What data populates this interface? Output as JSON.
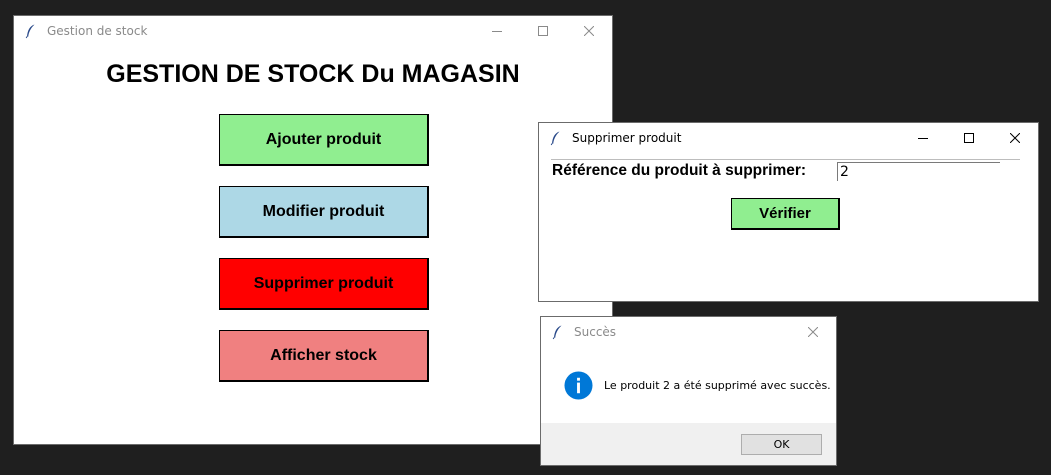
{
  "main_window": {
    "title": "Gestion de stock",
    "heading": "GESTION DE STOCK Du MAGASIN",
    "buttons": [
      {
        "label": "Ajouter produit",
        "color": "#90ee90"
      },
      {
        "label": "Modifier produit",
        "color": "#add8e6"
      },
      {
        "label": "Supprimer produit",
        "color": "#ff0000"
      },
      {
        "label": "Afficher stock",
        "color": "#f08080"
      }
    ]
  },
  "delete_window": {
    "title": "Supprimer produit",
    "reference_label": "Référence du produit à supprimer:",
    "reference_value": "2",
    "verify_label": "Vérifier",
    "verify_color": "#90ee90"
  },
  "success_dialog": {
    "title": "Succès",
    "message": "Le produit 2 a été supprimé avec succès.",
    "ok_label": "OK",
    "icon": "info-icon",
    "icon_color": "#0078d7"
  }
}
